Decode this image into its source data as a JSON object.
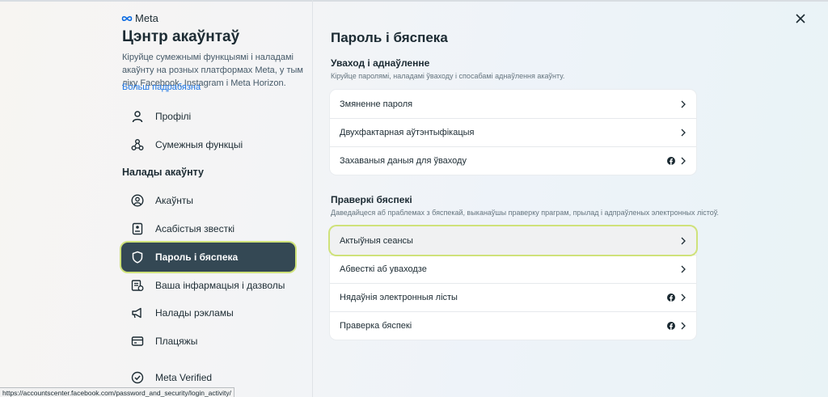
{
  "window": {
    "status_url": "https://accountscenter.facebook.com/password_and_security/login_activity/"
  },
  "brand": {
    "logo_text": "Meta"
  },
  "sidebar": {
    "title": "Цэнтр акаўнтаў",
    "description": "Кіруйце сумежнымі функцыямі і наладамі акаўнту на розных платформах Meta, у тым ліку Facebook, Instagram і Meta Horizon.",
    "more_link": "Больш падрабязна",
    "top_items": [
      {
        "label": "Профілі",
        "icon": "person-icon"
      },
      {
        "label": "Сумежныя функцыі",
        "icon": "connected-icon"
      }
    ],
    "section_label": "Налады акаўнту",
    "items": [
      {
        "label": "Акаўнты",
        "icon": "account-circle-icon"
      },
      {
        "label": "Асабістыя звесткі",
        "icon": "id-card-icon"
      },
      {
        "label": "Пароль і бяспека",
        "icon": "shield-icon",
        "active": true
      },
      {
        "label": "Ваша інфармацыя і дазволы",
        "icon": "info-permissions-icon"
      },
      {
        "label": "Налады рэкламы",
        "icon": "megaphone-icon"
      },
      {
        "label": "Плацяжы",
        "icon": "credit-card-icon"
      },
      {
        "label": "Meta Verified",
        "icon": "verified-badge-icon"
      }
    ]
  },
  "main": {
    "title": "Пароль і бяспека",
    "login_group": {
      "title": "Уваход і аднаўленне",
      "description": "Кіруйце паролямі, наладамі ўваходу і спосабамі аднаўлення акаўнту.",
      "rows": [
        {
          "label": "Змяненне пароля",
          "fb": false
        },
        {
          "label": "Двухфактарная аўтэнтыфікацыя",
          "fb": false
        },
        {
          "label": "Захаваныя даныя для ўваходу",
          "fb": true
        }
      ]
    },
    "security_group": {
      "title": "Праверкі бяспекі",
      "description": "Даведайцеся аб праблемах з бяспекай, выканаўшы праверку праграм, прылад і адпраўленых электронных лістоў.",
      "rows": [
        {
          "label": "Актыўныя сеансы",
          "fb": false,
          "highlighted": true
        },
        {
          "label": "Абвесткі аб уваходзе",
          "fb": false
        },
        {
          "label": "Нядаўнія электронныя лісты",
          "fb": true
        },
        {
          "label": "Праверка бяспекі",
          "fb": true
        }
      ]
    }
  },
  "colors": {
    "active_bg": "#344854",
    "highlight_ring": "#cfe27a",
    "link": "#1b74e4"
  }
}
